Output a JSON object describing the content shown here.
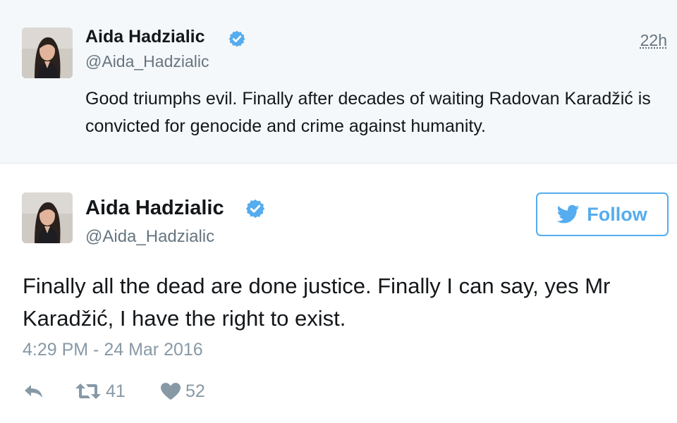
{
  "reply_tweet": {
    "display_name": "Aida Hadzialic",
    "handle": "@Aida_Hadzialic",
    "timestamp": "22h",
    "text": "Good triumphs evil. Finally after decades of waiting Radovan Karadžić is convicted for genocide and crime against humanity.",
    "avatar_icon": "profile-photo"
  },
  "main_tweet": {
    "display_name": "Aida Hadzialic",
    "handle": "@Aida_Hadzialic",
    "follow_label": "Follow",
    "text": "Finally all the dead are done justice. Finally I can say, yes Mr Karadžić, I have the right to exist.",
    "date": "4:29 PM - 24 Mar 2016",
    "actions": {
      "retweet_count": "41",
      "like_count": "52"
    },
    "avatar_icon": "profile-photo"
  },
  "colors": {
    "accent": "#55acee",
    "muted": "#8899a6",
    "reply_bg": "#f5f8fa"
  }
}
